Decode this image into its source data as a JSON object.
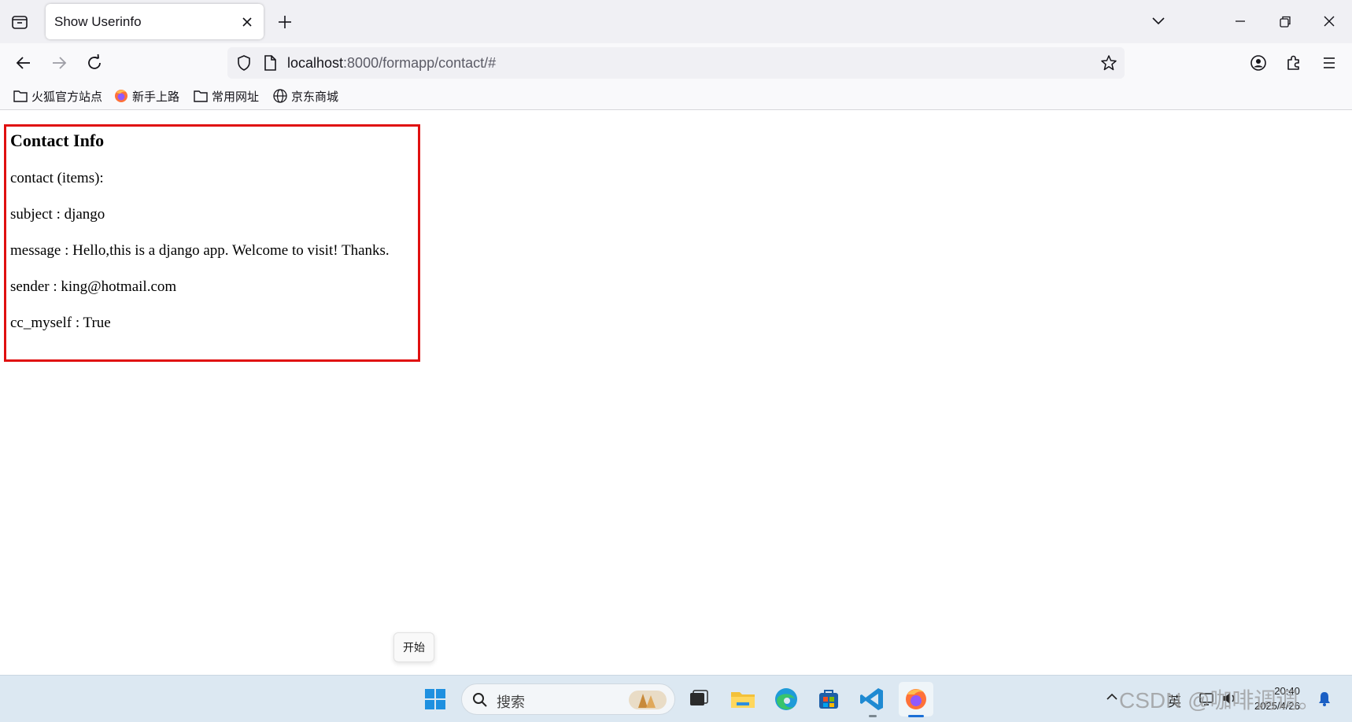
{
  "browser": {
    "tab_title": "Show Userinfo",
    "url_host": "localhost",
    "url_rest": ":8000/formapp/contact/#",
    "bookmarks": [
      {
        "label": "火狐官方站点",
        "icon": "folder-icon"
      },
      {
        "label": "新手上路",
        "icon": "firefox-icon"
      },
      {
        "label": "常用网址",
        "icon": "folder-icon"
      },
      {
        "label": "京东商城",
        "icon": "globe-icon"
      }
    ]
  },
  "page": {
    "heading": "Contact Info",
    "lines": {
      "intro": "contact (items):",
      "subject": "subject : django",
      "message": "message : Hello,this is a django app. Welcome to visit! Thanks.",
      "sender": "sender : king@hotmail.com",
      "cc_myself": "cc_myself : True"
    },
    "highlight_color": "#e01010"
  },
  "tooltip": "开始",
  "taskbar": {
    "search_placeholder": "搜索",
    "tray_lang": "英",
    "clock_time": "20:40",
    "clock_date": "2025/4/26"
  },
  "watermark": "CSDN @咖啡调调。"
}
